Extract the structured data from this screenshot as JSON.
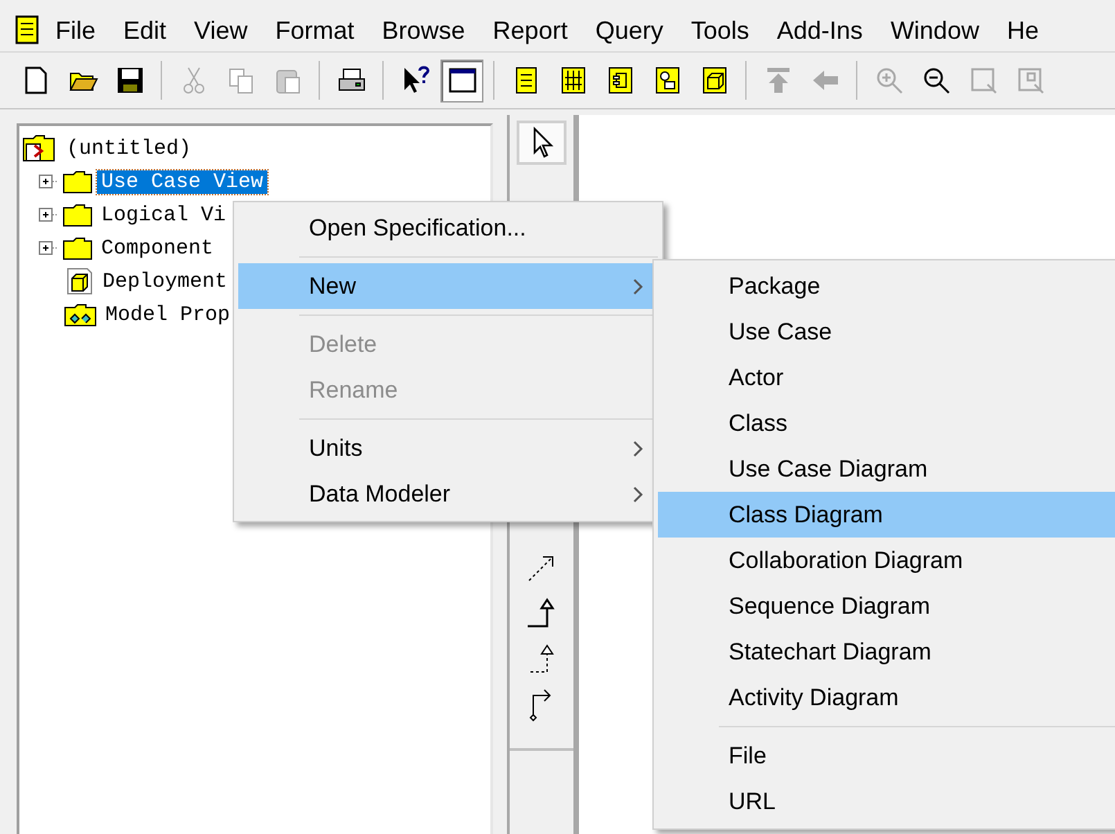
{
  "menu_bar": [
    {
      "label": "File"
    },
    {
      "label": "Edit"
    },
    {
      "label": "View"
    },
    {
      "label": "Format"
    },
    {
      "label": "Browse"
    },
    {
      "label": "Report"
    },
    {
      "label": "Query"
    },
    {
      "label": "Tools"
    },
    {
      "label": "Add-Ins"
    },
    {
      "label": "Window"
    },
    {
      "label": "He"
    }
  ],
  "toolbar": [
    {
      "kind": "new",
      "disabled": false,
      "pressed": false
    },
    {
      "kind": "open",
      "disabled": false,
      "pressed": false
    },
    {
      "kind": "save",
      "disabled": false,
      "pressed": false
    },
    {
      "kind": "separator"
    },
    {
      "kind": "cut",
      "disabled": true,
      "pressed": false
    },
    {
      "kind": "copy",
      "disabled": true,
      "pressed": false
    },
    {
      "kind": "paste",
      "disabled": true,
      "pressed": false
    },
    {
      "kind": "separator"
    },
    {
      "kind": "print",
      "disabled": false,
      "pressed": false
    },
    {
      "kind": "separator"
    },
    {
      "kind": "help",
      "disabled": false,
      "pressed": false
    },
    {
      "kind": "window",
      "disabled": false,
      "pressed": true
    },
    {
      "kind": "separator"
    },
    {
      "kind": "doc",
      "disabled": false,
      "pressed": false
    },
    {
      "kind": "bars",
      "disabled": false,
      "pressed": false
    },
    {
      "kind": "component",
      "disabled": false,
      "pressed": false
    },
    {
      "kind": "shapes",
      "disabled": false,
      "pressed": false
    },
    {
      "kind": "cube",
      "disabled": false,
      "pressed": false
    },
    {
      "kind": "separator"
    },
    {
      "kind": "up",
      "disabled": true,
      "pressed": false
    },
    {
      "kind": "back",
      "disabled": true,
      "pressed": false
    },
    {
      "kind": "separator"
    },
    {
      "kind": "zoom-in",
      "disabled": true,
      "pressed": false
    },
    {
      "kind": "zoom-out",
      "disabled": false,
      "pressed": false
    },
    {
      "kind": "fit",
      "disabled": true,
      "pressed": false
    },
    {
      "kind": "fit-selection",
      "disabled": true,
      "pressed": false
    }
  ],
  "browser_tree": {
    "label": "(untitled)",
    "children": [
      {
        "label": "Use Case View",
        "kind": "folder",
        "expandable": true,
        "selected": true
      },
      {
        "label": "Logical Vi",
        "kind": "folder",
        "expandable": true,
        "selected": false
      },
      {
        "label": "Component",
        "kind": "folder",
        "expandable": true,
        "selected": false
      },
      {
        "label": "Deployment",
        "kind": "cube",
        "expandable": false,
        "selected": false
      },
      {
        "label": "Model Prop",
        "kind": "properties",
        "expandable": false,
        "selected": false
      }
    ]
  },
  "palette": [
    {
      "kind": "pointer",
      "selected": true
    },
    {
      "kind": "dependency",
      "selected": false
    },
    {
      "kind": "generalization",
      "selected": false
    },
    {
      "kind": "realization",
      "selected": false
    },
    {
      "kind": "association",
      "selected": false
    }
  ],
  "context_menu": [
    {
      "kind": "item",
      "label": "Open Specification...",
      "disabled": false,
      "selected": false,
      "submenu": false
    },
    {
      "kind": "separator"
    },
    {
      "kind": "item",
      "label": "New",
      "disabled": false,
      "selected": true,
      "submenu": true
    },
    {
      "kind": "separator"
    },
    {
      "kind": "item",
      "label": "Delete",
      "disabled": true,
      "selected": false,
      "submenu": false
    },
    {
      "kind": "item",
      "label": "Rename",
      "disabled": true,
      "selected": false,
      "submenu": false
    },
    {
      "kind": "separator"
    },
    {
      "kind": "item",
      "label": "Units",
      "disabled": false,
      "selected": false,
      "submenu": true
    },
    {
      "kind": "item",
      "label": "Data Modeler",
      "disabled": false,
      "selected": false,
      "submenu": true
    }
  ],
  "submenu": [
    {
      "kind": "item",
      "label": "Package",
      "disabled": false,
      "selected": false,
      "submenu": false
    },
    {
      "kind": "item",
      "label": "Use Case",
      "disabled": false,
      "selected": false,
      "submenu": false
    },
    {
      "kind": "item",
      "label": "Actor",
      "disabled": false,
      "selected": false,
      "submenu": false
    },
    {
      "kind": "item",
      "label": "Class",
      "disabled": false,
      "selected": false,
      "submenu": false
    },
    {
      "kind": "item",
      "label": "Use Case Diagram",
      "disabled": false,
      "selected": false,
      "submenu": false
    },
    {
      "kind": "item",
      "label": "Class Diagram",
      "disabled": false,
      "selected": true,
      "submenu": false
    },
    {
      "kind": "item",
      "label": "Collaboration Diagram",
      "disabled": false,
      "selected": false,
      "submenu": false
    },
    {
      "kind": "item",
      "label": "Sequence Diagram",
      "disabled": false,
      "selected": false,
      "submenu": false
    },
    {
      "kind": "item",
      "label": "Statechart Diagram",
      "disabled": false,
      "selected": false,
      "submenu": false
    },
    {
      "kind": "item",
      "label": "Activity Diagram",
      "disabled": false,
      "selected": false,
      "submenu": false
    },
    {
      "kind": "separator"
    },
    {
      "kind": "item",
      "label": "File",
      "disabled": false,
      "selected": false,
      "submenu": false
    },
    {
      "kind": "item",
      "label": "URL",
      "disabled": false,
      "selected": false,
      "submenu": false
    }
  ]
}
